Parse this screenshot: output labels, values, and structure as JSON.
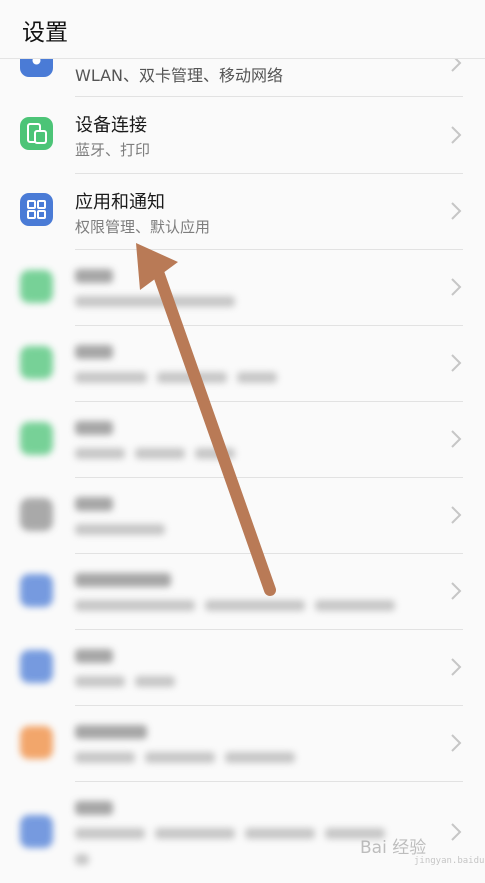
{
  "header": {
    "title": "设置"
  },
  "rows": [
    {
      "id": "wireless",
      "label": "",
      "subtitle": "WLAN、双卡管理、移动网络",
      "icon": "network-icon",
      "color": "#4a7bd6"
    },
    {
      "id": "device-connection",
      "label": "设备连接",
      "subtitle": "蓝牙、打印",
      "icon": "device-connection-icon",
      "color": "#4cc477"
    },
    {
      "id": "apps-notifications",
      "label": "应用和通知",
      "subtitle": "权限管理、默认应用",
      "icon": "apps-grid-icon",
      "color": "#4a7bd6"
    },
    {
      "id": "battery",
      "icon": "battery-icon",
      "color": "#4cc477"
    },
    {
      "id": "display",
      "icon": "display-icon",
      "color": "#4cc477"
    },
    {
      "id": "sound",
      "icon": "sound-icon",
      "color": "#4cc477"
    },
    {
      "id": "storage",
      "icon": "storage-icon",
      "color": "#8f8f8f"
    },
    {
      "id": "security-privacy",
      "icon": "security-icon",
      "color": "#4a7bd6"
    },
    {
      "id": "accounts",
      "icon": "account-icon",
      "color": "#4a7bd6"
    },
    {
      "id": "digital-balance",
      "icon": "balance-icon",
      "color": "#f08a3c"
    },
    {
      "id": "system",
      "icon": "system-icon",
      "color": "#4a7bd6"
    }
  ],
  "watermark": {
    "brand": "Bai 经验",
    "url": "jingyan.baidu.com"
  },
  "annotation": {
    "color": "#b97a56"
  }
}
